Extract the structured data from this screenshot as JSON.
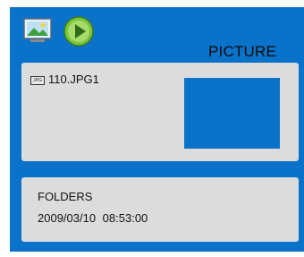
{
  "topbar": {
    "icons": [
      "picture-icon",
      "play-icon"
    ],
    "mode_title": "PICTURE"
  },
  "file_panel": {
    "badge": "JPG",
    "filename": "110.JPG1"
  },
  "info_panel": {
    "folders_label": "FOLDERS",
    "datetime": "2009/03/10   08:53:00"
  },
  "colors": {
    "background": "#0a72c8",
    "panel": "#dcdcdc",
    "thumbnail": "#0a72c8"
  }
}
